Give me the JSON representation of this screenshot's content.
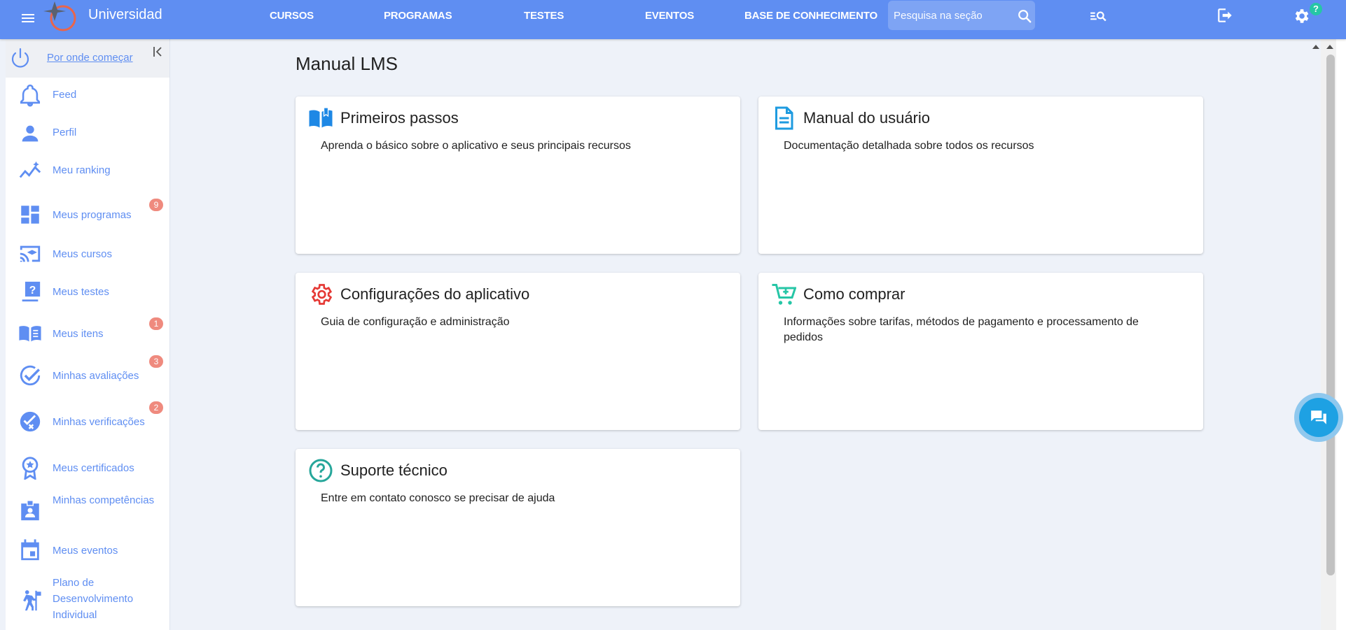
{
  "header": {
    "brand": "Universidad",
    "nav": [
      "CURSOS",
      "PROGRAMAS",
      "TESTES",
      "EVENTOS",
      "BASE DE CONHECIMENTO"
    ],
    "search_placeholder": "Pesquisa na seção",
    "help_badge": "?"
  },
  "sidebar": {
    "start_link": "Por onde começar",
    "items": [
      {
        "label": "Feed",
        "icon": "bell-icon"
      },
      {
        "label": "Perfil",
        "icon": "person-icon"
      },
      {
        "label": "Meu ranking",
        "icon": "ranking-icon"
      },
      {
        "label": "Meus programas",
        "icon": "dashboard-icon",
        "badge": "9"
      },
      {
        "label": "Meus cursos",
        "icon": "cast-education-icon"
      },
      {
        "label": "Meus testes",
        "icon": "quiz-icon"
      },
      {
        "label": "Meus itens",
        "icon": "book-icon",
        "badge": "1"
      },
      {
        "label": "Minhas avaliações",
        "icon": "check-circle-icon",
        "badge": "3"
      },
      {
        "label": "Minhas verificações",
        "icon": "verification-icon",
        "badge": "2"
      },
      {
        "label": "Meus certificados",
        "icon": "award-icon"
      },
      {
        "label": "Minhas competências",
        "icon": "badge-icon"
      },
      {
        "label": "Meus eventos",
        "icon": "calendar-icon"
      },
      {
        "label": "Plano de Desenvolvimento Individual",
        "icon": "hiker-icon"
      }
    ]
  },
  "main": {
    "title": "Manual LMS",
    "cards": [
      {
        "title": "Primeiros passos",
        "description": "Aprenda o básico sobre o aplicativo e seus principais recursos",
        "icon": "open-book-icon",
        "color": "#1e88e5"
      },
      {
        "title": "Manual do usuário",
        "description": "Documentação detalhada sobre todos os recursos",
        "icon": "document-icon",
        "color": "#1e9be0"
      },
      {
        "title": "Configurações do aplicativo",
        "description": "Guia de configuração e administração",
        "icon": "gear-icon",
        "color": "#e53935"
      },
      {
        "title": "Como comprar",
        "description": "Informações sobre tarifas, métodos de pagamento e processamento de pedidos",
        "icon": "cart-icon",
        "color": "#26c6a6"
      },
      {
        "title": "Suporte técnico",
        "description": "Entre em contato conosco se precisar de ajuda",
        "icon": "help-circle-icon",
        "color": "#26a69a"
      }
    ]
  },
  "colors": {
    "accent": "#5f8ef2",
    "badge": "#ef8a7e",
    "background": "#eef2f9"
  }
}
